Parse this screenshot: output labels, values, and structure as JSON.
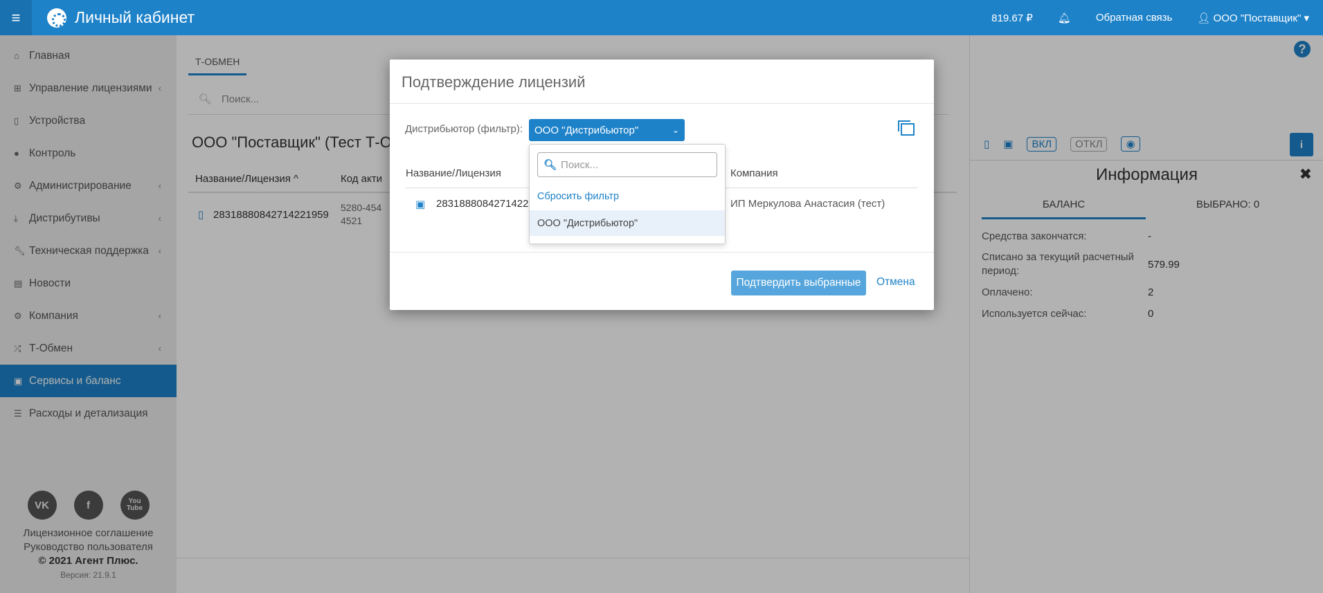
{
  "header": {
    "menu_icon": "hamburger-icon",
    "app_title": "Личный кабинет",
    "balance": "819.67 ₽",
    "feedback": "Обратная связь",
    "user": "ООО \"Поставщик\""
  },
  "sidebar": {
    "items": [
      {
        "label": "Главная",
        "icon": "home-icon"
      },
      {
        "label": "Управление лицензиями",
        "icon": "sitemap-icon"
      },
      {
        "label": "Устройства",
        "icon": "mobile-icon"
      },
      {
        "label": "Контроль",
        "icon": "globe-icon"
      },
      {
        "label": "Администрирование",
        "icon": "cogs-icon"
      },
      {
        "label": "Дистрибутивы",
        "icon": "download-icon"
      },
      {
        "label": "Техническая поддержка",
        "icon": "wrench-icon"
      },
      {
        "label": "Новости",
        "icon": "newspaper-icon"
      },
      {
        "label": "Компания",
        "icon": "gear-icon"
      },
      {
        "label": "Т-Обмен",
        "icon": "random-icon"
      },
      {
        "label": "Сервисы и баланс",
        "icon": "money-icon"
      },
      {
        "label": "Расходы и детализация",
        "icon": "list-icon"
      }
    ],
    "social": [
      "VK",
      "f",
      "You Tube"
    ],
    "license": "Лицензионное соглашение",
    "guide": "Руководство пользователя",
    "copyright": "© 2021 Агент Плюс.",
    "version": "Версия: 21.9.1"
  },
  "main": {
    "tab": "Т-ОБМЕН",
    "search_placeholder": "Поиск...",
    "company_title": "ООО \"Поставщик\" (Тест Т-О",
    "col_name": "Название/Лицензия ^",
    "col_code": "Код акти",
    "row_license": "28318880842714221959",
    "row_code_1": "5280-454",
    "row_code_2": "4521"
  },
  "right_panel": {
    "pill_on": "ВКЛ",
    "pill_off": "ОТКЛ",
    "title": "Информация",
    "tab_balance": "БАЛАНС",
    "tab_selected": "ВЫБРАНО: 0",
    "rows": [
      {
        "k": "Средства закончатся:",
        "v": "-"
      },
      {
        "k": "Списано за текущий расчетный период:",
        "v": "579.99"
      },
      {
        "k": "Оплачено:",
        "v": "2"
      },
      {
        "k": "Используется сейчас:",
        "v": "0"
      }
    ]
  },
  "modal": {
    "title": "Подтверждение лицензий",
    "filter_label": "Дистрибьютор (фильтр):",
    "filter_value": "ООО \"Дистрибьютор\"",
    "col_name": "Название/Лицензия",
    "col_company": "Компания",
    "row_license": "28318880842714221959",
    "row_company": "ИП Меркулова Анастасия (тест)",
    "confirm": "Подтвердить выбранные",
    "cancel": "Отмена"
  },
  "dropdown": {
    "search_placeholder": "Поиск...",
    "reset": "Сбросить фильтр",
    "option": "ООО \"Дистрибьютор\""
  }
}
